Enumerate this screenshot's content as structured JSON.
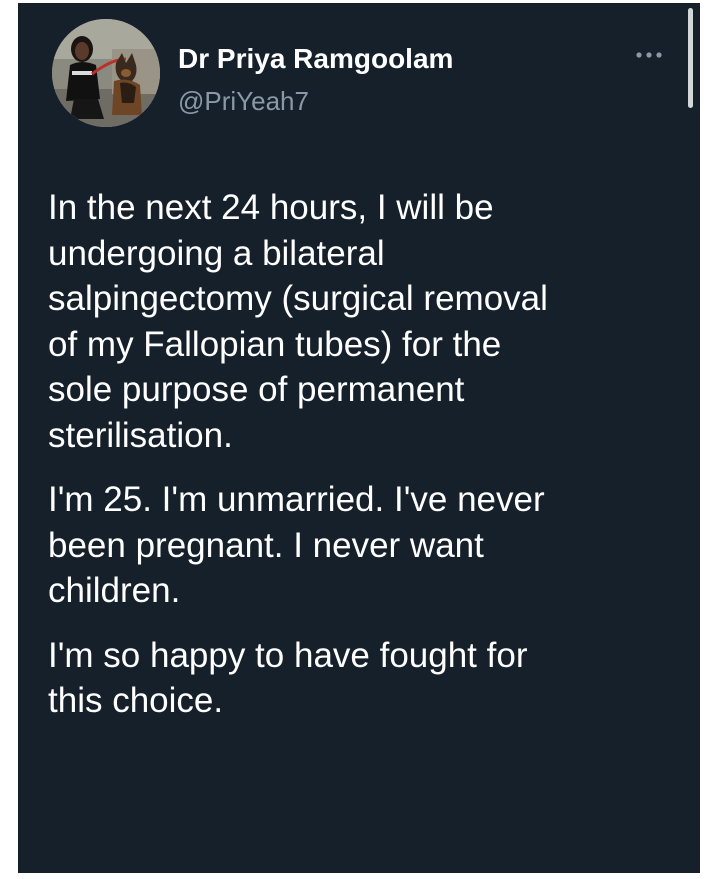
{
  "tweet": {
    "author_name": "Dr Priya Ramgoolam",
    "author_handle": "@PriYeah7",
    "paragraphs": [
      "In the next 24 hours, I will be\nundergoing a bilateral\nsalpingectomy (surgical removal\nof my Fallopian tubes) for the\nsole purpose of permanent\nsterilisation.",
      "I'm 25. I'm unmarried. I've never\nbeen pregnant. I never want\nchildren.",
      "I'm so happy to have fought for\nthis choice."
    ]
  },
  "icons": {
    "more": "more-horizontal-icon",
    "avatar": "profile-photo"
  },
  "colors": {
    "background": "#15202b",
    "text": "#ffffff",
    "secondary_text": "#8b98a5"
  }
}
